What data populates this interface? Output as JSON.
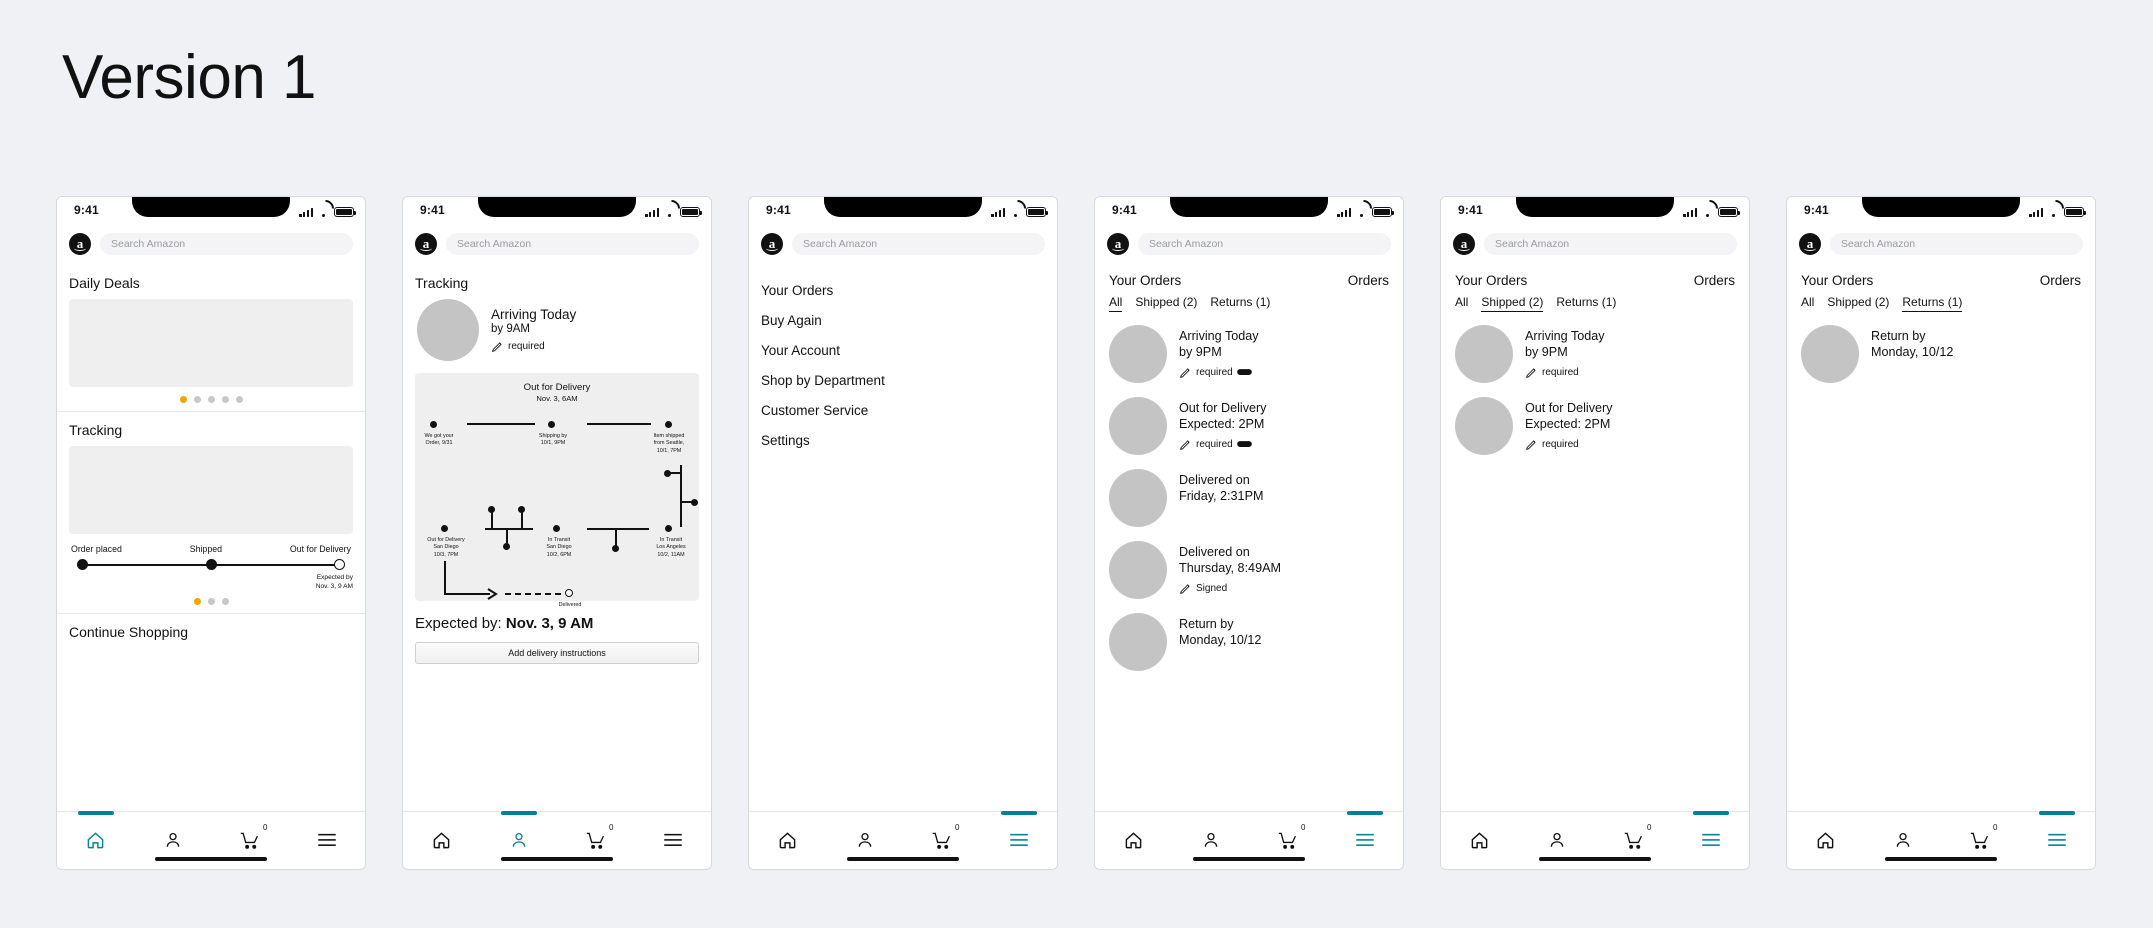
{
  "page": {
    "title": "Version 1"
  },
  "colors": {
    "accent_teal": "#008296",
    "accent_amber": "#f6a200",
    "skeleton": "#efefef",
    "avatar": "#c4c4c4"
  },
  "statusbar": {
    "time": "9:41",
    "wifi_icon": "wifi-icon",
    "signal_icon": "signal-bars-icon",
    "battery_icon": "battery-icon"
  },
  "search": {
    "placeholder": "Search Amazon",
    "logo": "amazon-logo-icon",
    "logo_letter": "a"
  },
  "bottom_nav": {
    "items": [
      {
        "name": "home",
        "icon": "home-icon",
        "label": ""
      },
      {
        "name": "account",
        "icon": "person-icon",
        "label": ""
      },
      {
        "name": "cart",
        "icon": "cart-icon",
        "badge": "0"
      },
      {
        "name": "menu",
        "icon": "hamburger-menu-icon",
        "label": ""
      }
    ]
  },
  "screens": [
    {
      "id": "home",
      "active_nav": 0,
      "sections": [
        {
          "title": "Daily Deals",
          "carousel_dots": 5,
          "active_dot": 0
        },
        {
          "title": "Tracking"
        },
        {
          "title": "Continue Shopping"
        }
      ],
      "tracker": {
        "steps": [
          "Order placed",
          "Shipped",
          "Out for Delivery"
        ],
        "eta_line1": "Expected by",
        "eta_line2": "Nov. 3, 9 AM",
        "dots": 3,
        "active_dot": 0
      }
    },
    {
      "id": "tracking-detail",
      "active_nav": 1,
      "title": "Tracking",
      "summary": {
        "line1": "Arriving Today",
        "line2": "by 9AM",
        "signature": "required",
        "pen_icon": "pen-signature-icon"
      },
      "map": {
        "heading": "Out for Delivery",
        "subheading": "Nov. 3, 6AM",
        "stops": [
          {
            "label": "We got your\nOrder, 9/31"
          },
          {
            "label": "Shipping by\n10/1, 9PM"
          },
          {
            "label": "Item shipped\nfrom Seattle,\n10/1, 7PM"
          },
          {
            "label": "Out for Delivery\nSan Diego\n10/3, 7PM"
          },
          {
            "label": "In Transit\nSan Diego\n10/2, 6PM"
          },
          {
            "label": "In Transit\nLos Angeles\n10/2, 11AM"
          },
          {
            "label": "Delivered"
          }
        ]
      },
      "expected_prefix": "Expected by: ",
      "expected_value": "Nov. 3, 9 AM",
      "button_label": "Add delivery instructions"
    },
    {
      "id": "menu",
      "active_nav": 3,
      "items": [
        "Your Orders",
        "Buy Again",
        "Your Account",
        "Shop by Department",
        "Customer Service",
        "Settings"
      ]
    },
    {
      "id": "orders-all",
      "active_nav": 3,
      "header_left": "Your Orders",
      "header_right": "Orders",
      "tabs": [
        {
          "label": "All",
          "active": true
        },
        {
          "label": "Shipped (2)",
          "active": false
        },
        {
          "label": "Returns (1)",
          "active": false
        }
      ],
      "orders": [
        {
          "line1": "Arriving Today",
          "line2": "by 9PM",
          "badge": "required",
          "pen_icon": "pen-signature-icon",
          "mask_icon": "face-mask-icon"
        },
        {
          "line1": "Out for Delivery",
          "line2": "Expected: 2PM",
          "badge": "required",
          "pen_icon": "pen-signature-icon",
          "mask_icon": "face-mask-icon"
        },
        {
          "line1": "Delivered on",
          "line2": "Friday, 2:31PM",
          "badge": "",
          "pen_icon": "",
          "mask_icon": ""
        },
        {
          "line1": "Delivered on",
          "line2": "Thursday, 8:49AM",
          "badge": "Signed",
          "pen_icon": "pen-signature-icon",
          "mask_icon": ""
        },
        {
          "line1": "Return by",
          "line2": "Monday, 10/12",
          "badge": "",
          "pen_icon": "",
          "mask_icon": ""
        }
      ]
    },
    {
      "id": "orders-shipped",
      "active_nav": 3,
      "header_left": "Your Orders",
      "header_right": "Orders",
      "tabs": [
        {
          "label": "All",
          "active": false
        },
        {
          "label": "Shipped (2)",
          "active": true
        },
        {
          "label": "Returns (1)",
          "active": false
        }
      ],
      "orders": [
        {
          "line1": "Arriving Today",
          "line2": "by 9PM",
          "badge": "required",
          "pen_icon": "pen-signature-icon",
          "mask_icon": ""
        },
        {
          "line1": "Out for Delivery",
          "line2": "Expected: 2PM",
          "badge": "required",
          "pen_icon": "pen-signature-icon",
          "mask_icon": ""
        }
      ]
    },
    {
      "id": "orders-returns",
      "active_nav": 3,
      "header_left": "Your Orders",
      "header_right": "Orders",
      "tabs": [
        {
          "label": "All",
          "active": false
        },
        {
          "label": "Shipped (2)",
          "active": false
        },
        {
          "label": "Returns (1)",
          "active": true
        }
      ],
      "orders": [
        {
          "line1": "Return by",
          "line2": "Monday, 10/12",
          "badge": "",
          "pen_icon": "",
          "mask_icon": ""
        }
      ]
    }
  ]
}
